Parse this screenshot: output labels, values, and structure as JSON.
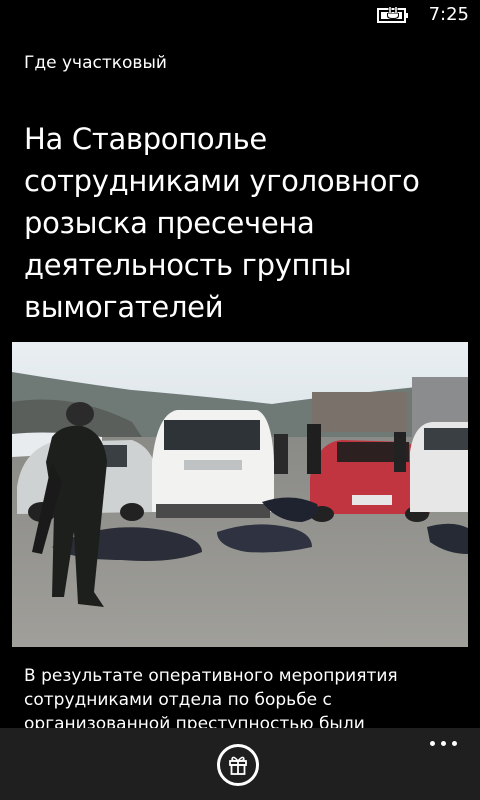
{
  "status_bar": {
    "time": "7:25",
    "battery_icon": "battery-charging-icon"
  },
  "app": {
    "name": "Где участковый"
  },
  "article": {
    "title": "На Ставрополье сотрудниками уголовного розыска пресечена деятельность  группы вымогателей",
    "image_icon": "news-photo",
    "body": "В результате оперативного мероприятия сотрудниками отдела по борьбе с организованной преступностью были"
  },
  "app_bar": {
    "primary_icon": "gift-icon",
    "more_icon": "ellipsis-icon"
  }
}
